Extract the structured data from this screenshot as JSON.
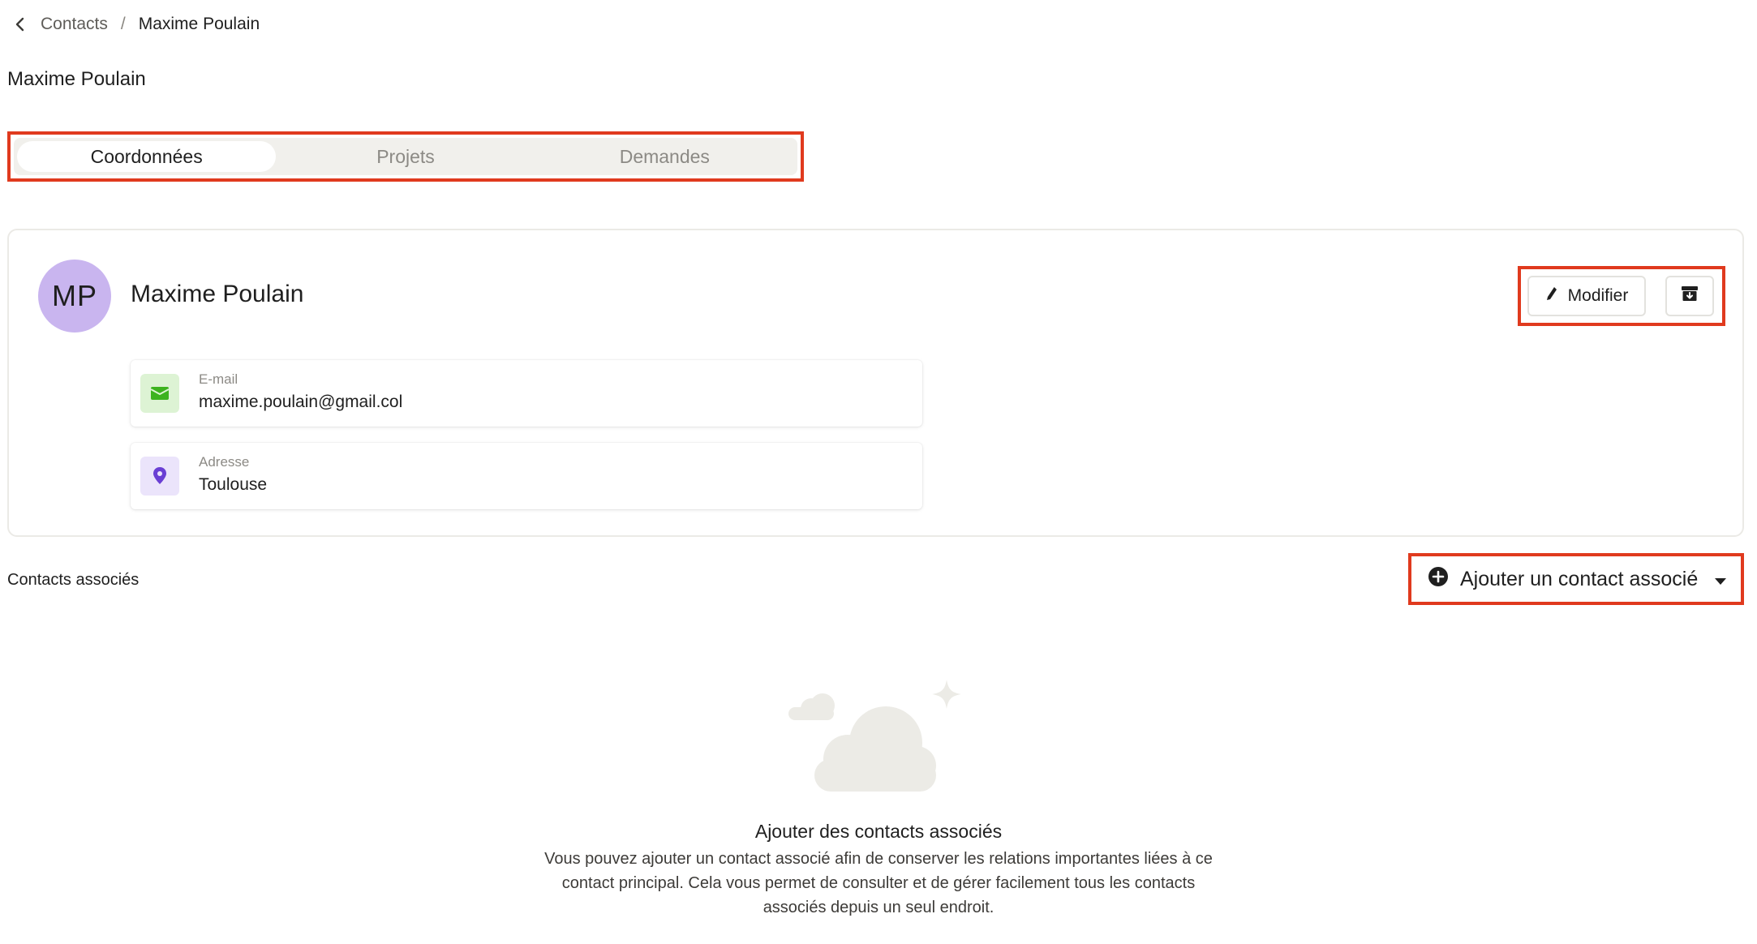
{
  "breadcrumb": {
    "parent": "Contacts",
    "separator": "/",
    "current": "Maxime Poulain"
  },
  "page": {
    "title": "Maxime Poulain"
  },
  "tabs": [
    {
      "label": "Coordonnées",
      "active": true
    },
    {
      "label": "Projets",
      "active": false
    },
    {
      "label": "Demandes",
      "active": false
    }
  ],
  "contact": {
    "initials": "MP",
    "name": "Maxime Poulain",
    "avatar_color": "#c9b5ef",
    "edit_label": "Modifier",
    "fields": {
      "email": {
        "label": "E-mail",
        "value": "maxime.poulain@gmail.col",
        "icon": "envelope-icon",
        "color": "#3db31f"
      },
      "address": {
        "label": "Adresse",
        "value": "Toulouse",
        "icon": "map-pin-icon",
        "color": "#6a3fd4"
      }
    }
  },
  "associated": {
    "title": "Contacts associés",
    "add_label": "Ajouter un contact associé"
  },
  "empty_state": {
    "title": "Ajouter des contacts associés",
    "description": "Vous pouvez ajouter un contact associé afin de conserver les relations importantes liées à ce contact principal. Cela vous permet de consulter et de gérer facilement tous les contacts associés depuis un seul endroit."
  },
  "colors": {
    "highlight": "#e03a1e",
    "tab_bg": "#f1f0ec",
    "illustration": "#ecebe6"
  }
}
